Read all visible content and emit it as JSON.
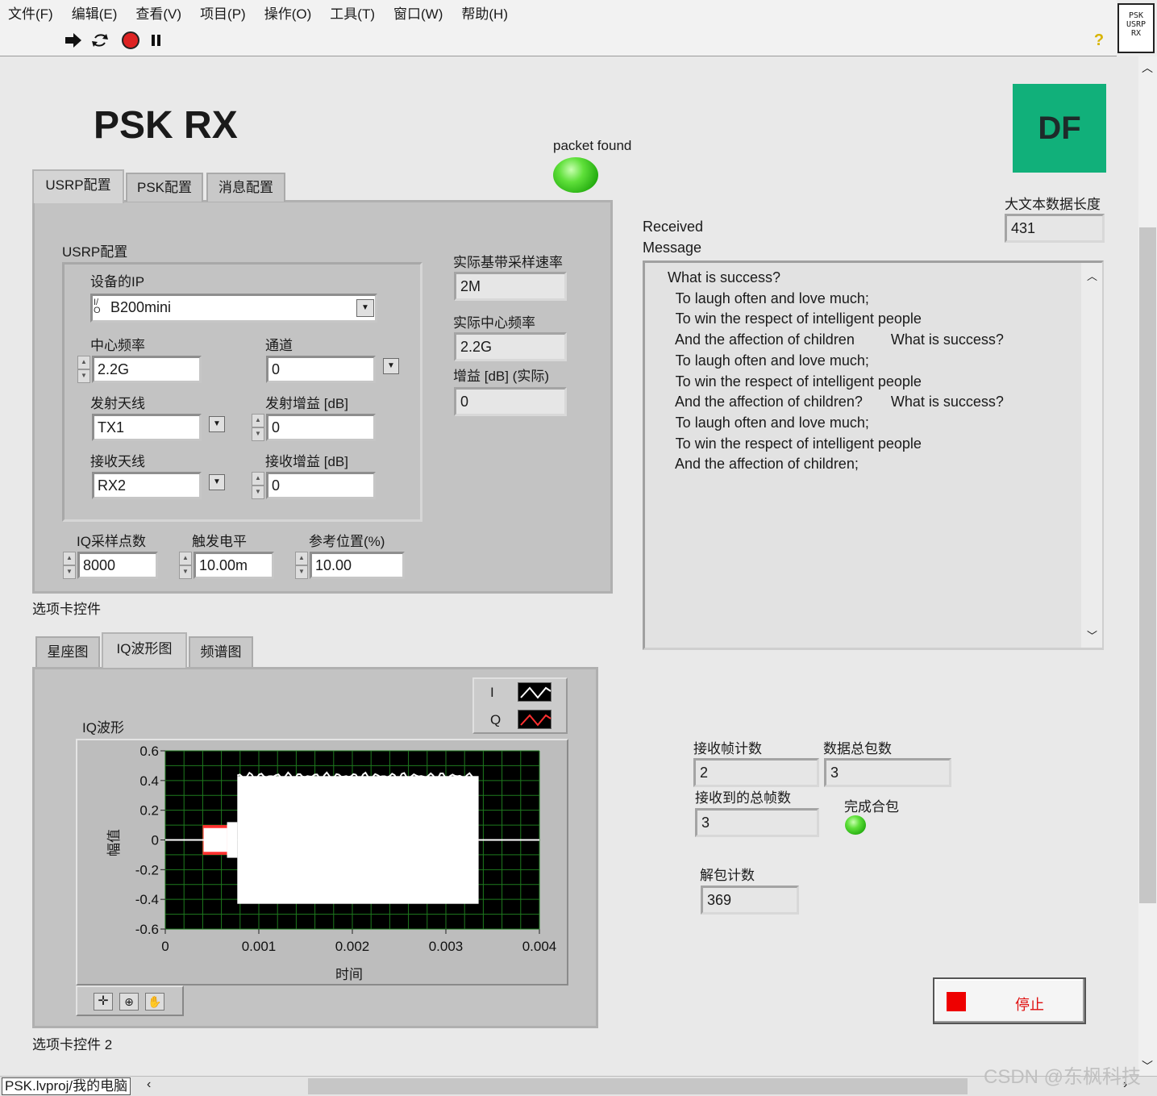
{
  "menu": [
    "文件(F)",
    "编辑(E)",
    "查看(V)",
    "项目(P)",
    "操作(O)",
    "工具(T)",
    "窗口(W)",
    "帮助(H)"
  ],
  "toolbar": {
    "icons": [
      "run-arrow-icon",
      "run-continuously-icon",
      "abort-icon",
      "pause-icon",
      "help-icon"
    ],
    "help": "?"
  },
  "vi_icon": {
    "line1": "PSK",
    "line2": "USRP",
    "line3": "RX"
  },
  "title": "PSK  RX",
  "logo": "DF",
  "packet_found": {
    "label": "packet found",
    "on": true,
    "color": "#3ad41a"
  },
  "tabs1": {
    "items": [
      "USRP配置",
      "PSK配置",
      "消息配置"
    ],
    "active": "USRP配置",
    "caption": "选项卡控件"
  },
  "usrp": {
    "group_label": "USRP配置",
    "ip_label": "设备的IP",
    "ip_value": "B200mini",
    "ip_prefix": "I/O",
    "center_freq_label": "中心频率",
    "center_freq": "2.2G",
    "channel_label": "通道",
    "channel": "0",
    "tx_ant_label": "发射天线",
    "tx_ant": "TX1",
    "tx_gain_label": "发射增益 [dB]",
    "tx_gain": "0",
    "rx_ant_label": "接收天线",
    "rx_ant": "RX2",
    "rx_gain_label": "接收增益 [dB]",
    "rx_gain": "0",
    "iq_samples_label": "IQ采样点数",
    "iq_samples": "8000",
    "trigger_label": "触发电平",
    "trigger": "10.00m",
    "ref_pos_label": "参考位置(%)",
    "ref_pos": "10.00"
  },
  "actual": {
    "rate_label": "实际基带采样速率",
    "rate": "2M",
    "freq_label": "实际中心频率",
    "freq": "2.2G",
    "gain_label": "增益 [dB] (实际)",
    "gain": "0"
  },
  "text_length": {
    "label": "大文本数据长度",
    "value": "431"
  },
  "received": {
    "label_line1": "Received",
    "label_line2": "Message",
    "lines": [
      "What is success?",
      "  To laugh often and love much;",
      "  To win the respect of intelligent people",
      "  And the affection of children         What is success?",
      "  To laugh often and love much;",
      "  To win the respect of intelligent people",
      "  And the affection of children?       What is success?",
      "  To laugh often and love much;",
      "  To win the respect of intelligent people",
      "  And the affection of children;"
    ]
  },
  "tabs2": {
    "items": [
      "星座图",
      "IQ波形图",
      "频谱图"
    ],
    "active": "IQ波形图",
    "caption": "选项卡控件 2"
  },
  "chart_data": {
    "type": "line",
    "title": "IQ波形",
    "xlabel": "时间",
    "ylabel": "幅值",
    "xlim": [
      0,
      0.004
    ],
    "ylim": [
      -0.6,
      0.6
    ],
    "x_ticks": [
      "0",
      "0.001",
      "0.002",
      "0.003",
      "0.004"
    ],
    "y_ticks": [
      "0.6",
      "0.4",
      "0.2",
      "0",
      "-0.2",
      "-0.4",
      "-0.6"
    ],
    "grid": true,
    "legend": "top-right",
    "series": [
      {
        "name": "I",
        "color": "#ffffff",
        "segments": [
          {
            "x_start": 0,
            "x_end": 0.00041,
            "amp": 0.005
          },
          {
            "x_start": 0.00041,
            "x_end": 0.00066,
            "amp": 0.08
          },
          {
            "x_start": 0.00066,
            "x_end": 0.00077,
            "amp": 0.12
          },
          {
            "x_start": 0.00077,
            "x_end": 0.00335,
            "amp": 0.43
          },
          {
            "x_start": 0.00335,
            "x_end": 0.004,
            "amp": 0.005
          }
        ]
      },
      {
        "name": "Q",
        "color": "#ff3030",
        "segments": [
          {
            "x_start": 0.0004,
            "x_end": 0.00067,
            "amp": 0.1
          },
          {
            "x_start": 0.00335,
            "x_end": 0.004,
            "amp": 0.008
          }
        ]
      }
    ],
    "plot_bg": "#000000",
    "grid_color": "#1e7a1e"
  },
  "counters": {
    "rx_frames_label": "接收帧计数",
    "rx_frames": "2",
    "total_packets_label": "数据总包数",
    "total_packets": "3",
    "total_rx_frames_label": "接收到的总帧数",
    "total_rx_frames": "3",
    "complete_label": "完成合包",
    "unpack_label": "解包计数",
    "unpack": "369"
  },
  "stop": {
    "label": "停止",
    "color": "#ee0000"
  },
  "status": {
    "path": "PSK.lvproj/我的电脑",
    "watermark": "CSDN @东枫科技"
  }
}
